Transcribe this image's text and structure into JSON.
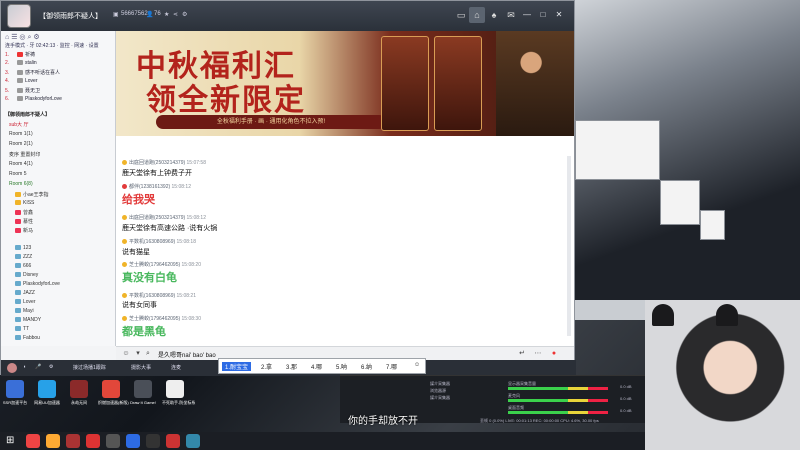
{
  "window": {
    "title": "【御领雨郎不疑人】",
    "room_id": "56667562",
    "online": "76",
    "controls": [
      "—",
      "□",
      "✕"
    ]
  },
  "sidebar": {
    "status_line": "连手模式 · 牙 02:42:13 · 监控 · 网速 · 设置",
    "rank": [
      {
        "no": "1.",
        "name": "祈祷"
      },
      {
        "no": "2.",
        "name": "stalin"
      },
      {
        "no": "3.",
        "name": "感不听话在喜人"
      },
      {
        "no": "4.",
        "name": "Lover"
      },
      {
        "no": "5.",
        "name": "聂无卫"
      },
      {
        "no": "6.",
        "name": "PlaskodyforLove"
      }
    ],
    "group_title": "【御领雨郎不疑人】",
    "sub_title": "sub大 厅",
    "roles": [
      {
        "label": "Room 1(1)"
      },
      {
        "label": "Room 2(1)"
      },
      {
        "label": "麦序 重置封印"
      },
      {
        "label": "Room 4(1)"
      },
      {
        "label": "Room 5"
      },
      {
        "label": "Room 6(8)"
      }
    ],
    "members": [
      "小ae王李指",
      "KISS",
      "曾鑫",
      "慕性",
      "新马",
      "",
      "123",
      "ZZZ",
      "666",
      "Disney",
      "PlaskodyforLove",
      "JAZZ",
      "Lover",
      "Mayi",
      "MANDY",
      "TT",
      "Fabbou",
      "kkkk"
    ]
  },
  "banner": {
    "line1": "中秋福利汇",
    "line2": "领全新限定",
    "line3": "全秋福利手册 · 画 · 通用化角色不拉入预!"
  },
  "chat": {
    "messages": [
      {
        "nick": "出庭回道跑(2503214379)",
        "time": "15:07:58",
        "text": "鹿天堂徐有上钟费子开",
        "style": "normal"
      },
      {
        "nick": "都伴(1238161392)",
        "time": "15:08:12",
        "text": "给我哭",
        "style": "big-red"
      },
      {
        "nick": "出庭回道跑(2503214379)",
        "time": "15:08:12",
        "text": "鹿天堂徐有高速公路 ·说有火锅",
        "style": "normal"
      },
      {
        "nick": "平数机(1630808969)",
        "time": "15:08:18",
        "text": "说有猫星",
        "style": "normal"
      },
      {
        "nick": "芝士腾蛟(1796462095)",
        "time": "15:08:20",
        "text": "真没有白龟",
        "style": "big-green"
      },
      {
        "nick": "平数机(1630808969)",
        "time": "15:08:21",
        "text": "说有女同事",
        "style": "normal"
      },
      {
        "nick": "芝士腾蛟(1796462095)",
        "time": "15:08:30",
        "text": "都是黑龟",
        "style": "big-green"
      }
    ]
  },
  "input": {
    "value": "是久嗯哥nai' bao' bao"
  },
  "ime": {
    "candidates": [
      "1.耐宝宝",
      "2.拿",
      "3.那",
      "4.哪",
      "5.呐",
      "6.纳",
      "7.哪"
    ]
  },
  "bottombar": {
    "items": [
      "接过场播1跟踪",
      "摄影大事",
      "连麦"
    ]
  },
  "obs": {
    "sources": [
      "媒介采集器",
      "浏览器源",
      "媒介采集器"
    ],
    "meters": [
      "显示器采集音量",
      "麦克风",
      "桌面音频"
    ],
    "values": [
      "0.0 dB",
      "0.0 dB",
      "0.0 dB"
    ],
    "status": "丢帧 0 (0.0%)  LIVE: 00:01:13  REC: 00:00:00  CPU: 4.6%, 30.00 fps"
  },
  "subtitle": "你的手却放不开",
  "desktop_icons": [
    "SSR加速平台",
    "网易UU加速器",
    "永劫无间",
    "炽燃加速器(新版)",
    "Draw It Game!",
    "不死助手-防坐标系"
  ],
  "colors": {
    "accent_red": "#b3231c",
    "msg_red": "#e23b3b",
    "msg_green": "#49b85e",
    "ime_selected": "#2d6be4"
  }
}
